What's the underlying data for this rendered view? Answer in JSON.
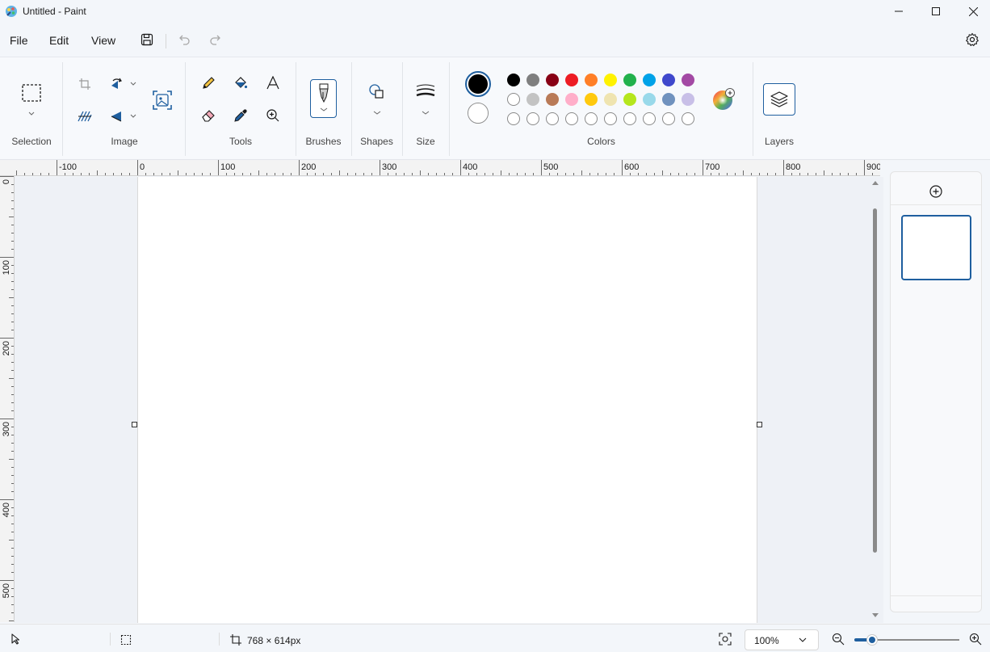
{
  "window": {
    "title": "Untitled - Paint"
  },
  "menu": {
    "file": "File",
    "edit": "Edit",
    "view": "View"
  },
  "ribbon": {
    "groups": {
      "selection": "Selection",
      "image": "Image",
      "tools": "Tools",
      "brushes": "Brushes",
      "shapes": "Shapes",
      "size": "Size",
      "colors": "Colors",
      "layers": "Layers"
    },
    "colors": {
      "primary": "#000000",
      "secondary": "#ffffff",
      "palette_row1": [
        "#000000",
        "#7f7f7f",
        "#880015",
        "#ed1c24",
        "#ff7f27",
        "#fff200",
        "#22b14c",
        "#00a2e8",
        "#3f48cc",
        "#a349a4"
      ],
      "palette_row2": [
        "#ffffff",
        "#c3c3c3",
        "#b97a57",
        "#ffaec9",
        "#ffc90e",
        "#efe4b0",
        "#b5e61d",
        "#99d9ea",
        "#7092be",
        "#c8bfe7"
      ]
    }
  },
  "ruler": {
    "horizontal": [
      "-100",
      "0",
      "100",
      "200",
      "300",
      "400",
      "500",
      "600",
      "700",
      "800",
      "900"
    ],
    "vertical": [
      "0",
      "100",
      "200",
      "300",
      "400",
      "500"
    ]
  },
  "status": {
    "canvas_size": "768 × 614px",
    "zoom": "100%"
  }
}
